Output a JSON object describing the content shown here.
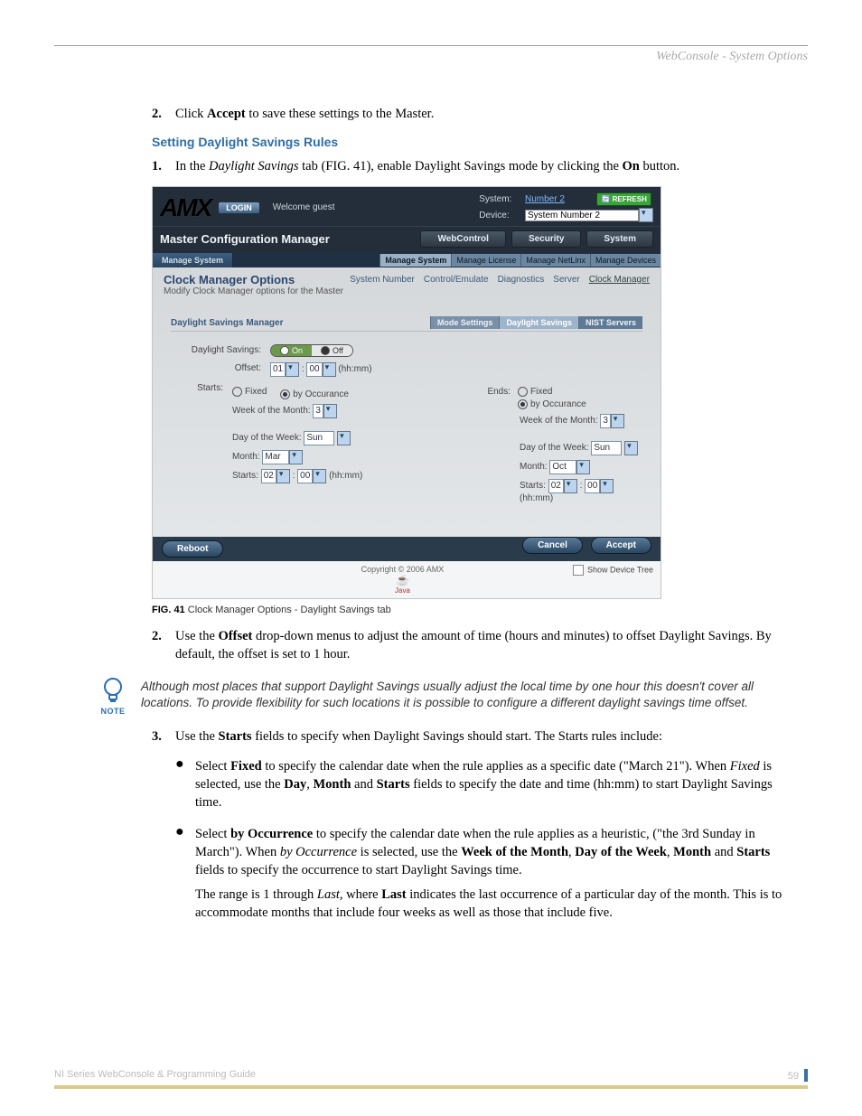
{
  "header": {
    "title": "WebConsole - System Options"
  },
  "step2_top": {
    "n": "2.",
    "pre": "Click ",
    "bold": "Accept",
    "post": " to save these settings to the Master."
  },
  "heading": "Setting Daylight Savings Rules",
  "step1": {
    "n": "1.",
    "pre": "In the ",
    "ital": "Daylight Savings",
    "mid": " tab (FIG. 41), enable Daylight Savings mode by clicking the ",
    "bold": "On",
    "post": " button."
  },
  "screenshot": {
    "login": "LOGIN",
    "welcome": "Welcome guest",
    "system_lbl": "System:",
    "system_val": "Number 2",
    "device_lbl": "Device:",
    "device_val": "System Number 2",
    "refresh": "REFRESH",
    "mcm": "Master Configuration Manager",
    "top_tabs": {
      "a": "WebControl",
      "b": "Security",
      "c": "System"
    },
    "ms_tab": "Manage System",
    "sub_tabs": {
      "a": "Manage System",
      "b": "Manage License",
      "c": "Manage NetLinx",
      "d": "Manage Devices"
    },
    "cmo_title": "Clock Manager Options",
    "cmo_sub": "Modify Clock Manager options for the Master",
    "mid_tabs": {
      "a": "System Number",
      "b": "Control/Emulate",
      "c": "Diagnostics",
      "d": "Server",
      "e": "Clock Manager"
    },
    "panel_title": "Daylight Savings Manager",
    "panel_tabs": {
      "a": "Mode Settings",
      "b": "Daylight Savings",
      "c": "NIST Servers"
    },
    "labels": {
      "ds": "Daylight Savings:",
      "offset": "Offset:",
      "starts": "Starts:",
      "ends": "Ends:",
      "fixed": "Fixed",
      "by_occ": "by Occurance",
      "wom": "Week of the Month:",
      "dow": "Day of the Week:",
      "month": "Month:",
      "starts_inner": "Starts:",
      "hhmm": "(hh:mm)",
      "on": "On",
      "off": "Off"
    },
    "values": {
      "offset_h": "01",
      "offset_m": "00",
      "s_wom": "3",
      "s_dow": "Sun",
      "s_month": "Mar",
      "s_h": "02",
      "s_m": "00",
      "e_wom": "3",
      "e_dow": "Sun",
      "e_month": "Oct",
      "e_h": "02",
      "e_m": "00"
    },
    "reboot": "Reboot",
    "cancel": "Cancel",
    "accept": "Accept",
    "copyright": "Copyright © 2006 AMX",
    "java": "Java",
    "show_tree": "Show Device Tree"
  },
  "caption": {
    "fig": "FIG. 41",
    "txt": "Clock Manager Options - Daylight Savings tab"
  },
  "step2_mid": {
    "n": "2.",
    "pre": "Use the ",
    "bold": "Offset",
    "post": " drop-down menus to adjust the amount of time (hours and minutes) to offset Daylight Savings. By default, the offset is set to 1 hour."
  },
  "note": {
    "label": "NOTE",
    "text": "Although most places that support Daylight Savings usually adjust the local time by one hour this doesn't cover all locations. To provide flexibility for such locations it is possible to configure a different daylight savings time offset."
  },
  "step3": {
    "n": "3.",
    "pre": "Use the ",
    "bold": "Starts",
    "post": " fields to specify when Daylight Savings should start. The Starts rules include:"
  },
  "bullets": {
    "b1": {
      "pre": "Select ",
      "b1": "Fixed",
      "mid1": " to specify the calendar date when the rule applies as a specific date (\"March 21\"). When ",
      "i1": "Fixed",
      "mid2": " is selected, use the ",
      "b2": "Day",
      "sep1": ", ",
      "b3": "Month",
      "sep2": " and ",
      "b4": "Starts",
      "post": " fields to specify the date and time (hh:mm) to start Daylight Savings time."
    },
    "b2": {
      "p1_pre": "Select ",
      "p1_b1": "by Occurrence",
      "p1_mid1": " to specify the calendar date when the rule applies as a heuristic, (\"the 3rd Sunday in March\"). When ",
      "p1_i1": "by Occurrence",
      "p1_mid2": " is selected, use the ",
      "p1_b2": "Week of the Month",
      "p1_sep1": ", ",
      "p1_b3": "Day of the Week",
      "p1_sep2": ", ",
      "p1_b4": "Month",
      "p1_sep3": " and ",
      "p1_b5": "Starts",
      "p1_post": " fields to specify the occurrence to start Daylight Savings time.",
      "p2_pre": "The range is 1 through ",
      "p2_i": "Last",
      "p2_mid": ", where ",
      "p2_b": "Last",
      "p2_post": " indicates the last occurrence of a particular day of the month. This is to accommodate months that include four weeks as well as those that include five."
    }
  },
  "footer": {
    "left": "NI Series WebConsole & Programming Guide",
    "page": "59"
  }
}
